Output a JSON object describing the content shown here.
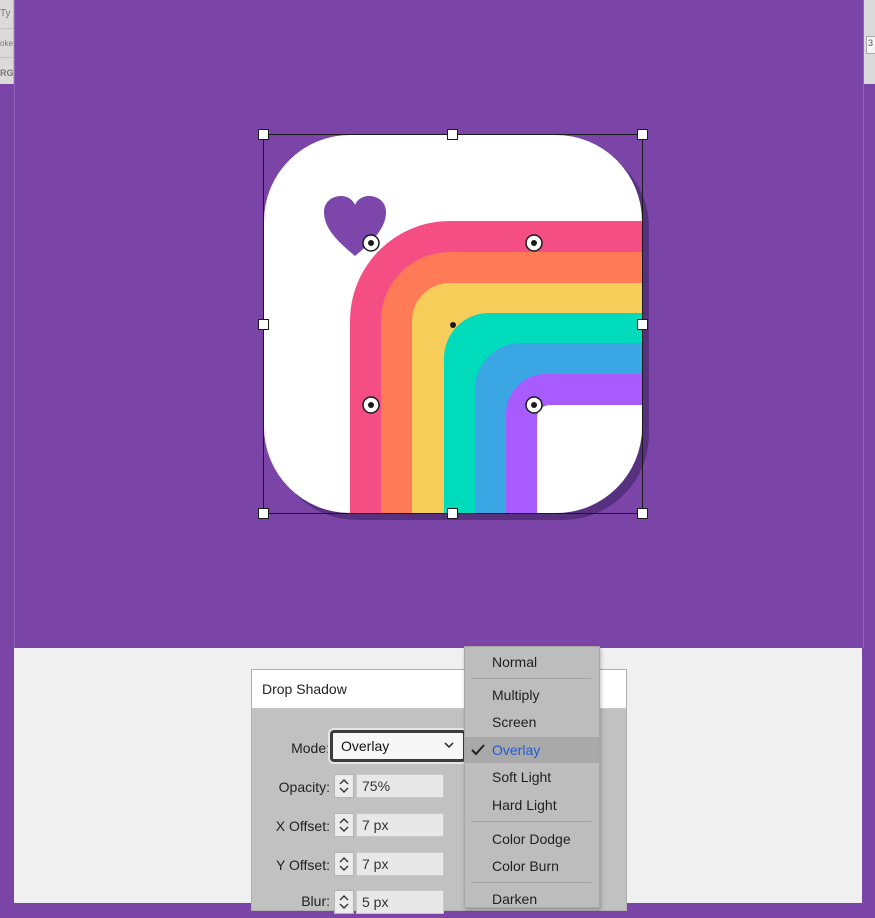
{
  "chrome": {
    "left_top_text": "Ty",
    "left_mid_text": "oke:",
    "left_bottom_text": "RG",
    "right_text": "3"
  },
  "colors": {
    "artboard": "#7b45a8",
    "heart": "#7c46aa",
    "rainbow": [
      "#f44e85",
      "#ff7a56",
      "#f7cd5a",
      "#00dbbc",
      "#3aa6e3",
      "#a85cff"
    ],
    "menu_selected_text": "#1e5bd6"
  },
  "dialog": {
    "title": "Drop Shadow",
    "mode_label": "Mode:",
    "mode_value": "Overlay",
    "opacity_label": "Opacity:",
    "opacity_value": "75%",
    "x_offset_label": "X Offset:",
    "x_offset_value": "7 px",
    "y_offset_label": "Y Offset:",
    "y_offset_value": "7 px",
    "blur_label": "Blur:",
    "blur_value": "5 px"
  },
  "blend_menu": {
    "items": [
      "Normal",
      "Multiply",
      "Screen",
      "Overlay",
      "Soft Light",
      "Hard Light",
      "Color Dodge",
      "Color Burn",
      "Darken"
    ],
    "selected": "Overlay"
  },
  "icons": {
    "check": "checkmark-icon",
    "chevron": "chevron-down-icon",
    "spinner": "up-down-arrows-icon",
    "heart": "heart-icon"
  }
}
